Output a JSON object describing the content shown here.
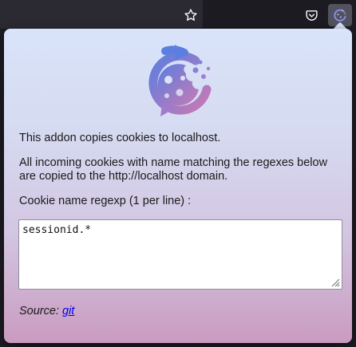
{
  "toolbar": {
    "icons": [
      "star-icon",
      "pocket-icon",
      "cookie-addon-icon"
    ]
  },
  "panel": {
    "intro": "This addon copies cookies to localhost.",
    "description": "All incoming cookies with name matching the regexes below are copied to the http://localhost domain.",
    "regex_label": "Cookie name regexp (1 per line) :",
    "regex_value": "sessionid.*",
    "source_label": "Source:",
    "source_link": "git"
  },
  "colors": {
    "toolbar_bg": "#1c1b22",
    "panel_top": "#d9e3f9",
    "panel_bottom": "#c99bc0",
    "logo_blue": "#5c7ee0",
    "logo_pink": "#c87ab4",
    "link": "#0000ee"
  }
}
